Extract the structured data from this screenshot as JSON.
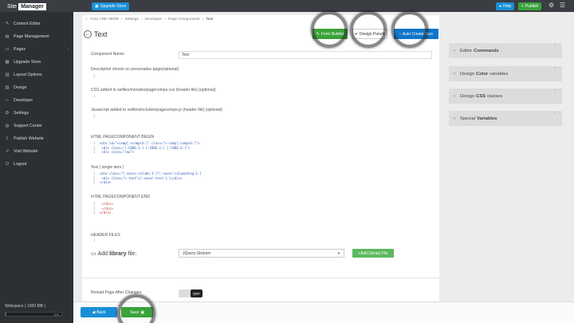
{
  "app": {
    "logo_a": "Site",
    "logo_b": "Manager",
    "upgrade_label": "Upgrade Store",
    "help_label": "Help",
    "publish_label": "Publish"
  },
  "sidebar": {
    "items": [
      {
        "label": "Content Editor",
        "icon": "pencil-icon"
      },
      {
        "label": "Page Management",
        "icon": "page-icon"
      },
      {
        "label": "Pages",
        "icon": "folder-icon",
        "arrow": "›"
      },
      {
        "label": "Upgrade Store",
        "icon": "cart-icon"
      },
      {
        "label": "Layout Options",
        "icon": "layout-icon"
      },
      {
        "label": "Design",
        "icon": "brush-icon"
      },
      {
        "label": "Developer",
        "icon": "code-icon"
      },
      {
        "label": "Settings",
        "icon": "gear-icon"
      },
      {
        "label": "Support Center",
        "icon": "support-icon"
      },
      {
        "label": "Publish Website",
        "icon": "upload-icon"
      },
      {
        "label": "Visit Website",
        "icon": "external-icon"
      },
      {
        "label": "Logout",
        "icon": "power-icon"
      }
    ],
    "webspace": "Webspace ( 1000 MB )",
    "webspace_pct": "0%",
    "webspace_fill": 0.01
  },
  "breadcrumb": {
    "home": "YOU ARE HERE",
    "items": [
      "Settings",
      "Developer",
      "Page Components",
      "Text"
    ]
  },
  "page": {
    "title": "Text",
    "form_builder": "Form Builder",
    "design_panels": "Design Panels",
    "auto_create_vars": "Auto Create Vars"
  },
  "form": {
    "component_name_label": "Component Name:",
    "component_name_value": "Text",
    "description_label": "Description shown on personalise page(optional)",
    "css_label": "CSS added to swfiles/includes/pagecomps.css (header file) (optional)",
    "js_label": "Javascript added to swfiles/includes/pagecomps.js (header file) (optional)",
    "begin_label": "HTML PAGECOMPONENT BEGIN",
    "text_label": "Text",
    "text_note": "( single item )",
    "end_label": "HTML PAGECOMPONENT END",
    "header_files_label": "HEADER FILES",
    "library_label_a": "Add",
    "library_label_b": "library",
    "library_label_c": "file:",
    "library_value": "JQuery-Stickem",
    "add_library_label": "Add Library File",
    "reload_label": "Reload Page After Changes",
    "toggle_state": "OFF"
  },
  "code": {
    "one": "1",
    "begin_lines": [
      {
        "n": "1",
        "t": "<div id=\"scomp[:scompid:]\" class=\"s-comp[:compid:]\">"
      },
      {
        "n": "2",
        "t": "  <div class=\"[:CODE:1:] [:CODE:1:] [:CODE:2:]\">"
      },
      {
        "n": "3",
        "t": "    <div class=\"row\">"
      }
    ],
    "text_lines": [
      {
        "n": "1",
        "t": "<div class=\"[:saver:column:1:]\"[:saver:columndrag:1:]"
      },
      {
        "n": "2",
        "t": "  <div class=\"s-text\">[:saver:text:1:]</div>"
      },
      {
        "n": "3",
        "t": "</div>"
      }
    ],
    "end_lines": [
      {
        "n": "1",
        "t": "    </div>"
      },
      {
        "n": "2",
        "t": "  </div>"
      },
      {
        "n": "3",
        "t": "</div>"
      }
    ]
  },
  "panels": [
    {
      "prefix": "Editor",
      "bold": "Commands",
      "suffix": ""
    },
    {
      "prefix": "Design",
      "bold": "Color",
      "suffix": "variables"
    },
    {
      "prefix": "Design",
      "bold": "CSS",
      "suffix": "classes"
    },
    {
      "prefix": "Special",
      "bold": "Variables",
      "suffix": ""
    }
  ],
  "footer": {
    "back_label": "Back",
    "save_label": "Save"
  },
  "colors": {
    "topbar": "#3a3e42",
    "sidebar": "#2c3033",
    "accent_blue": "#1a8fd5",
    "accent_green": "#3aa33a",
    "sky": "#1075c9"
  }
}
